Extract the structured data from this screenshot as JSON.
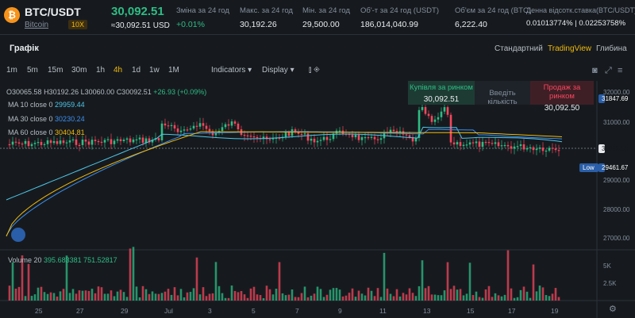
{
  "header": {
    "coin_icon": "₿",
    "pair": "BTC/USDT",
    "coin_name": "Bitcoin",
    "leverage": "10X",
    "last_price": "30,092.51",
    "usd_price": "≈30,092.51 USD",
    "stats": [
      {
        "label": "Зміна за 24 год",
        "value": "+0.01%",
        "color": "green"
      },
      {
        "label": "Макс. за 24 год",
        "value": "30,192.26",
        "color": ""
      },
      {
        "label": "Мін. за 24 год",
        "value": "29,500.00",
        "color": ""
      },
      {
        "label": "Об'-т за 24 год (USDT)",
        "value": "186,014,040.99",
        "color": ""
      },
      {
        "label": "Об'єм за 24 год (BTC)",
        "value": "6,222.40",
        "color": ""
      },
      {
        "label": "Денна відсотк.ставка(BTC/USDT)",
        "value": "0.01013774% | 0.02253758%",
        "color": ""
      }
    ]
  },
  "chart_panel": {
    "title": "Графік",
    "view_tabs": [
      "Стандартний",
      "TradingView",
      "Глибина"
    ],
    "active_view": 1
  },
  "toolbar": {
    "timeframes": [
      "1m",
      "5m",
      "15m",
      "30m",
      "1h",
      "4h",
      "1d",
      "1w",
      "1M"
    ],
    "active_timeframe": 5,
    "indicators_label": "Indicators",
    "display_label": "Display"
  },
  "legend": {
    "ohlc": {
      "o": "O30065.58",
      "h": "H30192.26",
      "l": "L30060.00",
      "c": "C30092.51",
      "chg": "+26.93 (+0.09%)"
    },
    "ma10": {
      "label": "MA 10 close 0",
      "value": "29959.44"
    },
    "ma30": {
      "label": "MA 30 close 0",
      "value": "30230.24"
    },
    "ma60": {
      "label": "MA 60 close 0",
      "value": "30404.81"
    },
    "volume": {
      "label": "Volume 20",
      "v1": "395.683381",
      "v2": "751.52817"
    }
  },
  "trade": {
    "buy_label": "Купівля за ринком",
    "buy_price": "30,092.51",
    "qty_placeholder": "Введіть кількість",
    "sell_label": "Продаж за ринком",
    "sell_price": "30,092.50"
  },
  "price_axis": {
    "ticks": [
      "32000.00",
      "31000.00",
      "30000.00",
      "29000.00",
      "28000.00",
      "27000.00"
    ],
    "tag_top": "31847.69",
    "tag_current": "30092.51",
    "low_label": "Low",
    "low_value": "29461.67"
  },
  "volume_axis": {
    "ticks": [
      "5K",
      "2.5K"
    ]
  },
  "date_axis": {
    "labels": [
      "25",
      "27",
      "29",
      "Jul",
      "3",
      "5",
      "7",
      "9",
      "11",
      "13",
      "15",
      "17",
      "19"
    ]
  },
  "colors": {
    "up": "#2ebd85",
    "down": "#f6465d",
    "accent": "#f0b90b",
    "ma10": "#4ec6e8",
    "ma30": "#3d8ef0",
    "ma60": "#f0b90b"
  },
  "icons": [
    "camera-icon",
    "expand-icon",
    "settings-icon",
    "gear-icon"
  ]
}
